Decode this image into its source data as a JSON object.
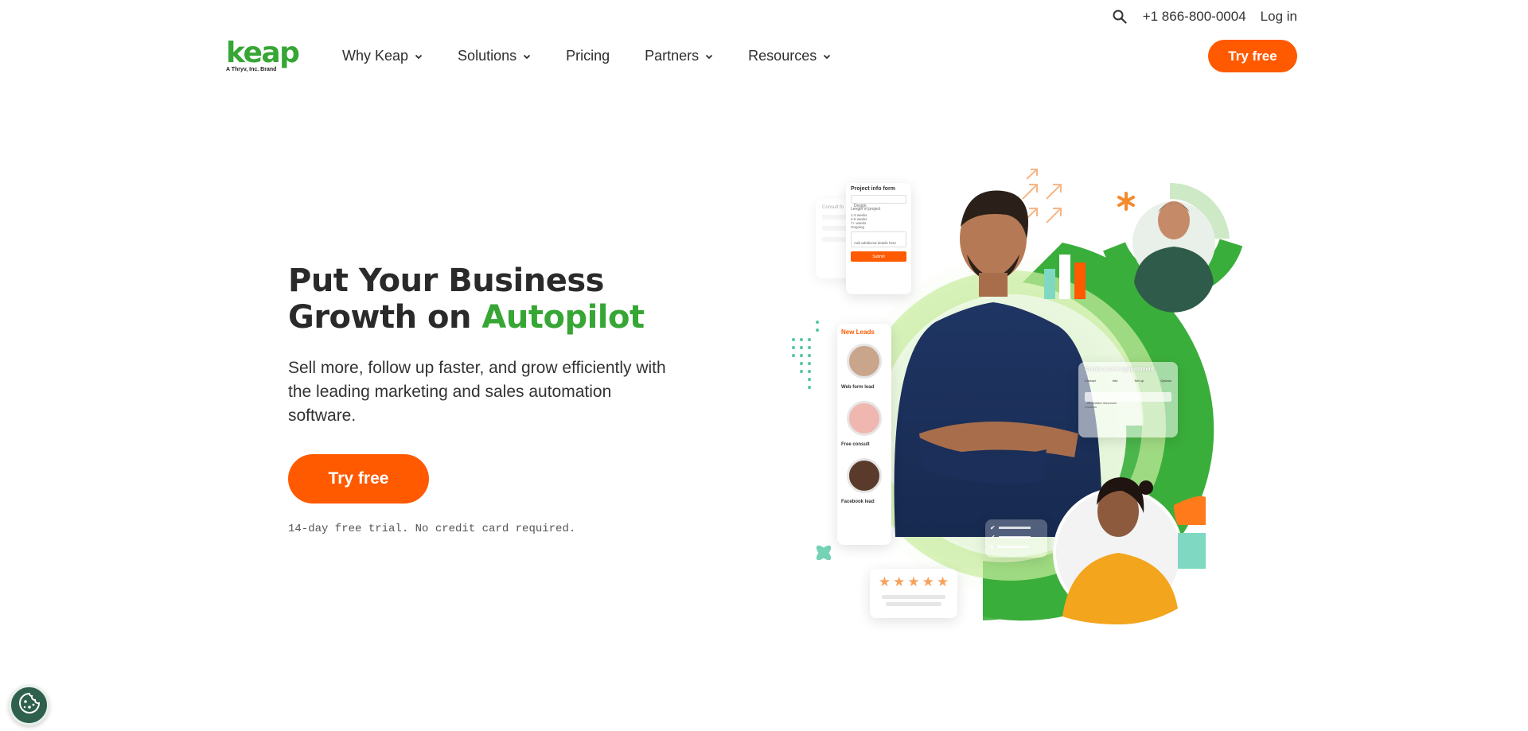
{
  "utility": {
    "phone": "+1 866-800-0004",
    "login": "Log in"
  },
  "logo": {
    "word": "keap",
    "tagline": "A Thryv, Inc. Brand"
  },
  "nav": {
    "items": [
      {
        "label": "Why Keap",
        "has_dropdown": true
      },
      {
        "label": "Solutions",
        "has_dropdown": true
      },
      {
        "label": "Pricing",
        "has_dropdown": false
      },
      {
        "label": "Partners",
        "has_dropdown": true
      },
      {
        "label": "Resources",
        "has_dropdown": true
      }
    ],
    "cta": "Try free"
  },
  "hero": {
    "title_line1": "Put Your Business",
    "title_line2_prefix": "Growth on ",
    "title_accent": "Autopilot",
    "subtitle": "Sell more, follow up faster, and grow efficiently with the leading marketing and sales automation software.",
    "cta": "Try free",
    "note": "14-day free trial. No credit card required."
  },
  "illustration": {
    "project_form_title": "Project info form",
    "project_form_select": "Design",
    "project_form_length": "Length of project",
    "project_form_options": [
      "1-3 weeks",
      "4-6 weeks",
      "7+ weeks",
      "Ongoing"
    ],
    "project_form_textarea": "Add additional details here",
    "project_form_submit": "Submit",
    "consult_label": "Consult fo",
    "new_leads_title": "New Leads",
    "leads": [
      "Web form lead",
      "Free consult",
      "Facebook lead"
    ],
    "appointment_title": "Create a new appointment",
    "appointment_steps": [
      "Contact",
      "Info",
      "Set up",
      "Options"
    ],
    "appointment_field": "All contact resources",
    "appointment_location": "Location",
    "stars": 5
  },
  "colors": {
    "brand_green": "#37a635",
    "brand_orange": "#ff5a00",
    "text_dark": "#2a2a2a",
    "cookie_bg": "#2f5f4d"
  }
}
